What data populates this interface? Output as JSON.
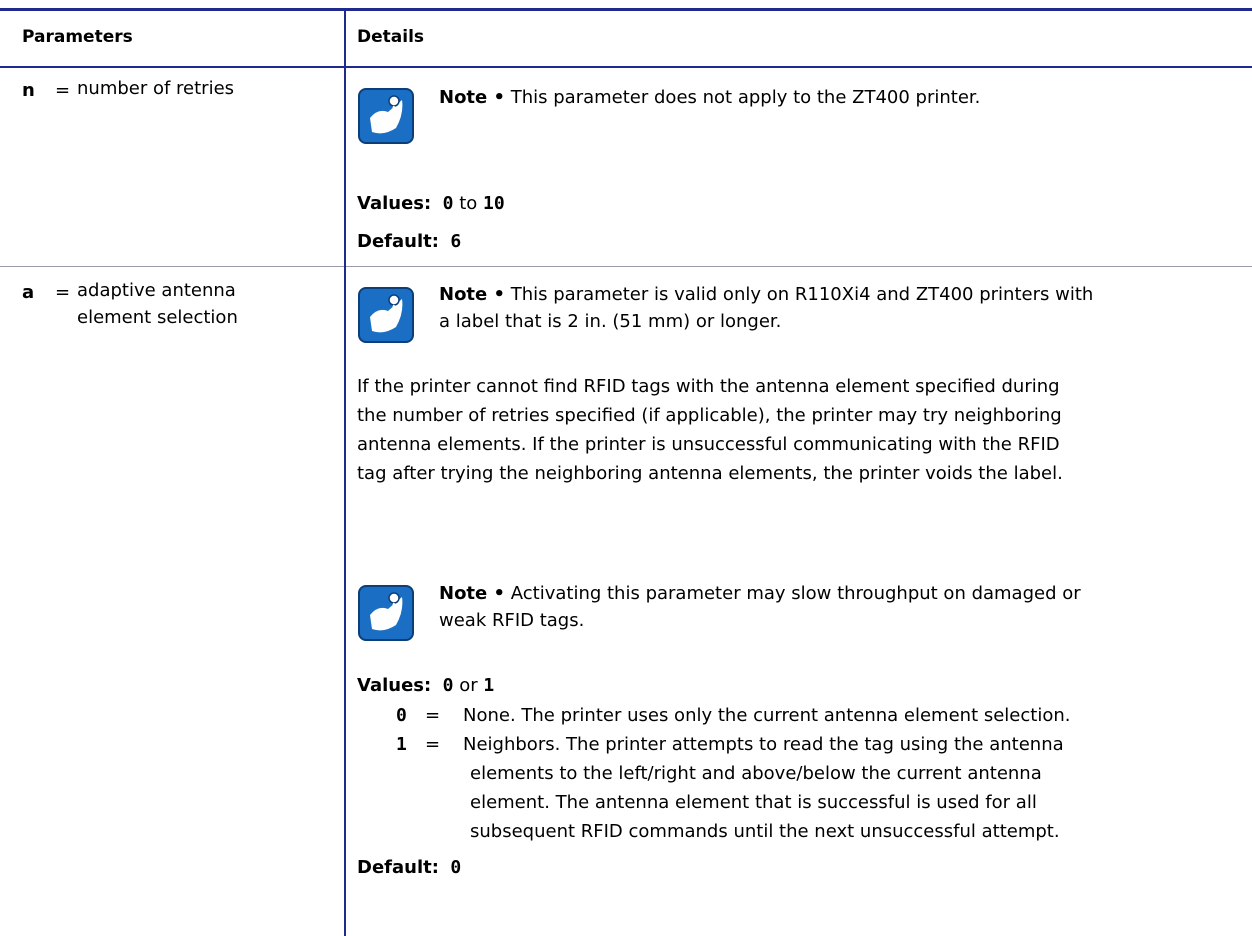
{
  "header": {
    "col1": "Parameters",
    "col2": "Details"
  },
  "rows": [
    {
      "param": "n",
      "eq": "=",
      "desc": "number of retries",
      "note_label": "Note •",
      "note_text": "This parameter does not apply to the ZT400 printer.",
      "values_label": "Values:",
      "values_from": "0",
      "values_to_word": "to",
      "values_to": "10",
      "default_label": "Default:",
      "default_value": "6"
    },
    {
      "param": "a",
      "eq": "=",
      "desc_line1": "adaptive antenna",
      "desc_line2": "element selection",
      "note1_label": "Note •",
      "note1_line1": "This parameter is valid only on R110Xi4 and ZT400 printers with",
      "note1_line2": "a label that is 2 in. (51 mm) or longer.",
      "para_lines": [
        "If the printer cannot find RFID tags with the antenna element specified during",
        "the number of retries specified (if applicable), the printer may try neighboring",
        "antenna elements. If the printer is unsuccessful communicating with the RFID",
        "tag after trying the neighboring antenna elements, the printer voids the label."
      ],
      "note2_label": "Note •",
      "note2_line1": "Activating this parameter may slow throughput on damaged or",
      "note2_line2": "weak RFID tags.",
      "values_label": "Values:",
      "values_a": "0",
      "values_or": "or",
      "values_b": "1",
      "options": [
        {
          "key": "0",
          "eq": "=",
          "lines": [
            "None. The printer uses only the current antenna element selection."
          ]
        },
        {
          "key": "1",
          "eq": "=",
          "lines": [
            "Neighbors. The printer attempts to read the tag using the antenna",
            "elements to the left/right and above/below the current antenna",
            "element. The antenna element that is successful is used for all",
            "subsequent RFID commands until the next unsuccessful attempt."
          ]
        }
      ],
      "default_label": "Default:",
      "default_value": "0"
    }
  ],
  "icons": {
    "note": "note-pad-icon"
  },
  "colors": {
    "rule": "#1f2a8c",
    "icon_blue": "#1a6fc4"
  }
}
